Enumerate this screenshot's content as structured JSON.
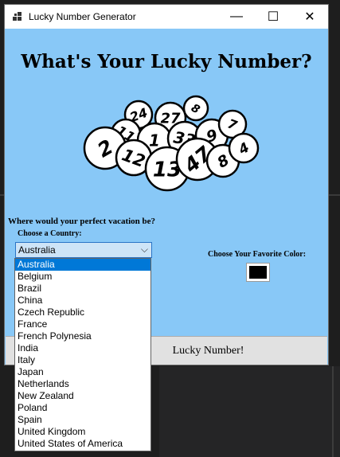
{
  "window": {
    "title": "Lucky Number Generator",
    "minimize_glyph": "—",
    "maximize_glyph": "☐",
    "close_glyph": "✕"
  },
  "main": {
    "heading": "What's Your Lucky Number?",
    "question": "Where would your perfect vacation be?",
    "country_label": "Choose a Country:",
    "country_selected": "Australia",
    "color_label": "Choose Your Favorite Color:",
    "favorite_color": "#000000",
    "lucky_button_label": "Lucky Number!"
  },
  "balls": [
    "24",
    "27",
    "8",
    "11",
    "1",
    "33",
    "9",
    "7",
    "2",
    "12",
    "13",
    "47",
    "8",
    "4"
  ],
  "dropdown": {
    "options": [
      "Australia",
      "Belgium",
      "Brazil",
      "China",
      "Czech Republic",
      "France",
      "French Polynesia",
      "India",
      "Italy",
      "Japan",
      "Netherlands",
      "New Zealand",
      "Poland",
      "Spain",
      "United Kingdom",
      "United States of America"
    ],
    "selected_index": 0
  },
  "colors": {
    "window_bg": "#88c8f7",
    "selection": "#0078d7"
  }
}
